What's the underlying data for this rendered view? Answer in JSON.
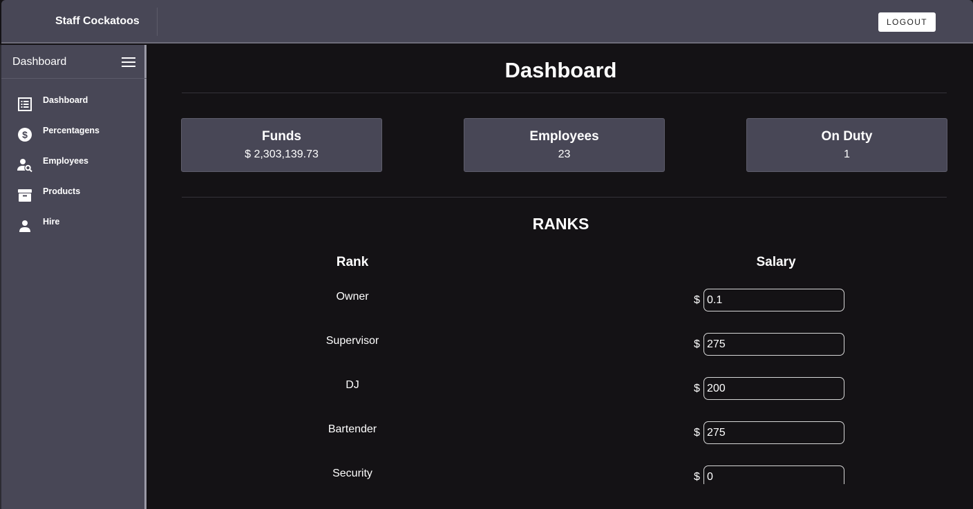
{
  "app": {
    "brand": "Staff Cockatoos",
    "logout_label": "LOGOUT"
  },
  "sidebar": {
    "title": "Dashboard",
    "items": [
      {
        "label": "Dashboard",
        "icon": "list-icon"
      },
      {
        "label": "Percentagens",
        "icon": "dollar-circle-icon"
      },
      {
        "label": "Employees",
        "icon": "person-search-icon"
      },
      {
        "label": "Products",
        "icon": "archive-box-icon"
      },
      {
        "label": "Hire",
        "icon": "person-icon"
      }
    ]
  },
  "main": {
    "title": "Dashboard",
    "cards": [
      {
        "title": "Funds",
        "value": "$ 2,303,139.73"
      },
      {
        "title": "Employees",
        "value": "23"
      },
      {
        "title": "On Duty",
        "value": "1"
      }
    ],
    "ranks": {
      "title": "RANKS",
      "col_rank": "Rank",
      "col_salary": "Salary",
      "currency": "$",
      "rows": [
        {
          "rank": "Owner",
          "salary": "0.1"
        },
        {
          "rank": "Supervisor",
          "salary": "275"
        },
        {
          "rank": "DJ",
          "salary": "200"
        },
        {
          "rank": "Bartender",
          "salary": "275"
        },
        {
          "rank": "Security",
          "salary": "0"
        }
      ]
    }
  },
  "colors": {
    "panel": "#484756",
    "background": "#141215",
    "text": "#ffffff"
  }
}
